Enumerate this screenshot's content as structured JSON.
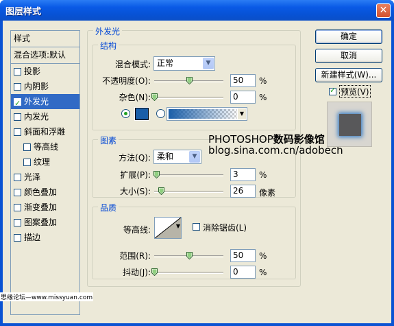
{
  "window": {
    "title": "图层样式",
    "close_glyph": "✕"
  },
  "style_list": {
    "header": "样式",
    "blend_options": "混合选项:默认",
    "items": [
      {
        "label": "投影",
        "checked": false,
        "selected": false,
        "sub": false
      },
      {
        "label": "内阴影",
        "checked": false,
        "selected": false,
        "sub": false
      },
      {
        "label": "外发光",
        "checked": true,
        "selected": true,
        "sub": false
      },
      {
        "label": "内发光",
        "checked": false,
        "selected": false,
        "sub": false
      },
      {
        "label": "斜面和浮雕",
        "checked": false,
        "selected": false,
        "sub": false
      },
      {
        "label": "等高线",
        "checked": false,
        "selected": false,
        "sub": true
      },
      {
        "label": "纹理",
        "checked": false,
        "selected": false,
        "sub": true
      },
      {
        "label": "光泽",
        "checked": false,
        "selected": false,
        "sub": false
      },
      {
        "label": "颜色叠加",
        "checked": false,
        "selected": false,
        "sub": false
      },
      {
        "label": "渐变叠加",
        "checked": false,
        "selected": false,
        "sub": false
      },
      {
        "label": "图案叠加",
        "checked": false,
        "selected": false,
        "sub": false
      },
      {
        "label": "描边",
        "checked": false,
        "selected": false,
        "sub": false
      }
    ]
  },
  "outer_glow": {
    "title": "外发光",
    "structure": {
      "title": "结构",
      "blend_mode_label": "混合模式:",
      "blend_mode_value": "正常",
      "opacity_label": "不透明度(O):",
      "opacity_value": "50",
      "opacity_level": 0.5,
      "noise_label": "杂色(N):",
      "noise_value": "0",
      "noise_level": 0,
      "percent": "%",
      "glow_color": "#1a5ea8"
    },
    "elements": {
      "title": "图素",
      "technique_label": "方法(Q):",
      "technique_value": "柔和",
      "spread_label": "扩展(P):",
      "spread_value": "3",
      "spread_level": 0.03,
      "size_label": "大小(S):",
      "size_value": "26",
      "size_unit": "像素",
      "size_level": 0.1,
      "percent": "%"
    },
    "quality": {
      "title": "品质",
      "contour_label": "等高线:",
      "antialias_label": "消除锯齿(L)",
      "antialias_checked": false,
      "range_label": "范围(R):",
      "range_value": "50",
      "range_level": 0.5,
      "jitter_label": "抖动(J):",
      "jitter_value": "0",
      "jitter_level": 0,
      "percent": "%"
    }
  },
  "buttons": {
    "ok": "确定",
    "cancel": "取消",
    "new_style": "新建样式(W)...",
    "preview_label": "预览(V)",
    "preview_checked": true
  },
  "watermark": {
    "line1_prefix": "PHOTOSHOP",
    "line1_suffix": "数码影像馆",
    "line2": "blog.sina.com.cn/adobech",
    "footer": "思缘论坛—www.missyuan.com"
  },
  "icons": {
    "close": "close-icon",
    "dropdown": "chevron-down-icon",
    "slider": "slider-thumb-icon"
  }
}
